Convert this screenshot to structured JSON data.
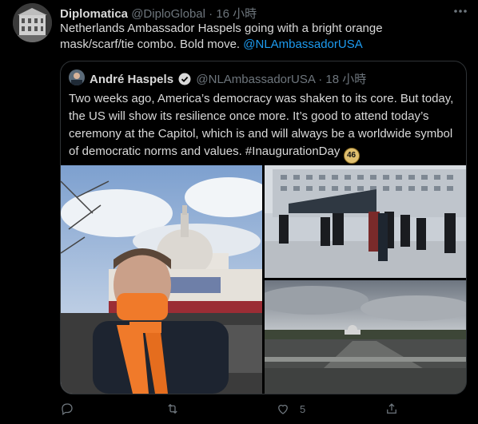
{
  "tweet": {
    "display_name": "Diplomatica",
    "handle": "@DiploGlobal",
    "separator": "·",
    "time": "16 小時",
    "text": "Netherlands Ambassador Haspels going with a bright orange mask/scarf/tie combo. Bold move.",
    "mention": "@NLAmbassadorUSA"
  },
  "quoted": {
    "display_name": "André Haspels",
    "handle": "@NLAmbassadorUSA",
    "separator": "·",
    "time": "18 小時",
    "text": "Two weeks ago, America’s democracy was shaken to its core. But today, the US will show its resilience once more. It’s good to attend today’s ceremony at the Capitol, which is and will always be a worldwide symbol of democratic norms and values. #InaugurationDay",
    "badge": "46"
  },
  "actions": {
    "reply_count": "",
    "retweet_count": "",
    "like_count": "5",
    "share_count": ""
  },
  "icons": {
    "more": "more-horizontal-icon",
    "verified": "verified-badge-icon",
    "reply": "reply-icon",
    "retweet": "retweet-icon",
    "like": "heart-icon",
    "share": "share-icon"
  },
  "colors": {
    "background": "#000000",
    "text": "#d9d9d9",
    "muted": "#6e767d",
    "link": "#1d9bf0",
    "border": "#2f3336",
    "mask_orange": "#f07a2a"
  }
}
